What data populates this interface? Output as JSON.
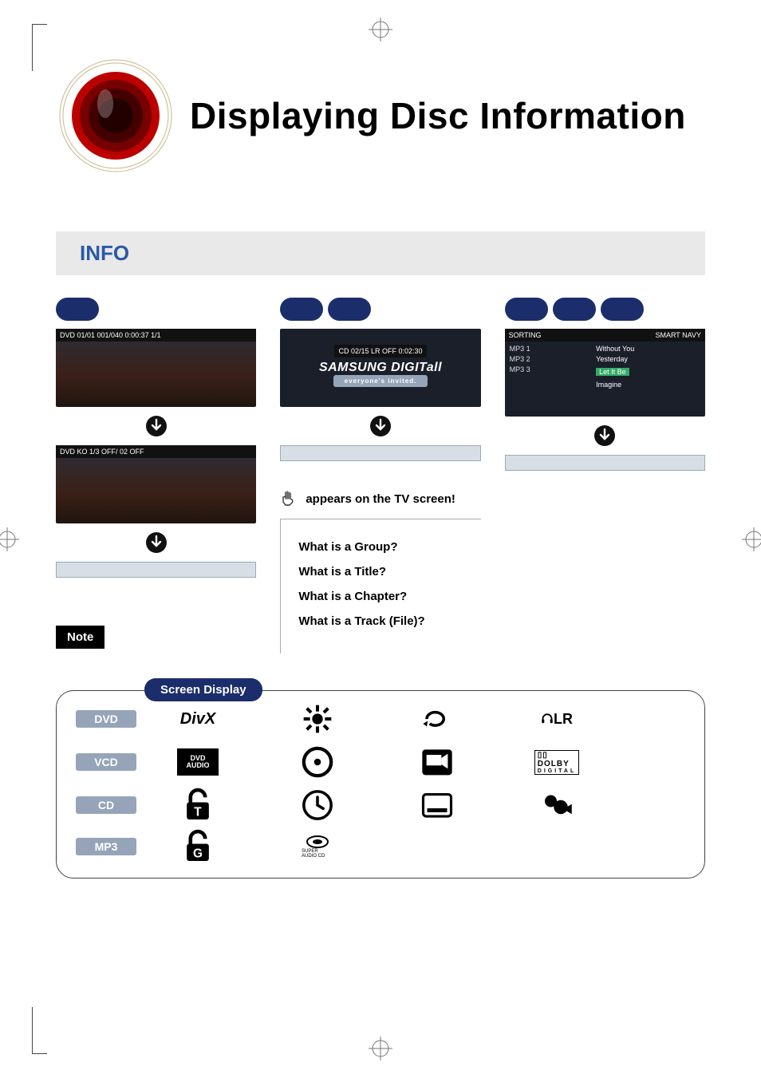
{
  "page_title": "Displaying Disc Information",
  "band_label": "INFO",
  "appears_text": "appears on the TV screen!",
  "note_label": "Note",
  "qa": {
    "q1": "What is a Group?",
    "q2": "What is a Title?",
    "q3": "What is a Chapter?",
    "q4": "What is a Track (File)?"
  },
  "screen_display_label": "Screen Display",
  "tags": {
    "dvd": "DVD",
    "vcd": "VCD",
    "cd": "CD",
    "mp3": "MP3"
  },
  "divx_label": "DivX",
  "dvd_audio_label_1": "DVD",
  "dvd_audio_label_2": "AUDIO",
  "lr_label": "LR",
  "dolby_top": "DOLBY",
  "dolby_bot": "DIGITAL",
  "sacd_label": "SUPER AUDIO CD",
  "shot_dvd1_bar": "DVD   01/01   001/040   0:00:37   1/1",
  "shot_dvd2_bar": "DVD   KO 1/3   OFF/ 02   OFF",
  "shot_cd_bar": "CD   02/15   LR   OFF   0:02:30",
  "shot_cd_logo": "SAMSUNG DIGITall",
  "shot_cd_tag": "everyone's invited.",
  "shot_mp3_sort": "SORTING",
  "shot_mp3_smart": "SMART NAVY",
  "shot_mp3_folders": [
    "MP3 1",
    "MP3 2",
    "MP3 3"
  ],
  "shot_mp3_tracks": [
    "Without You",
    "Yesterday",
    "Let It Be",
    "Imagine"
  ]
}
